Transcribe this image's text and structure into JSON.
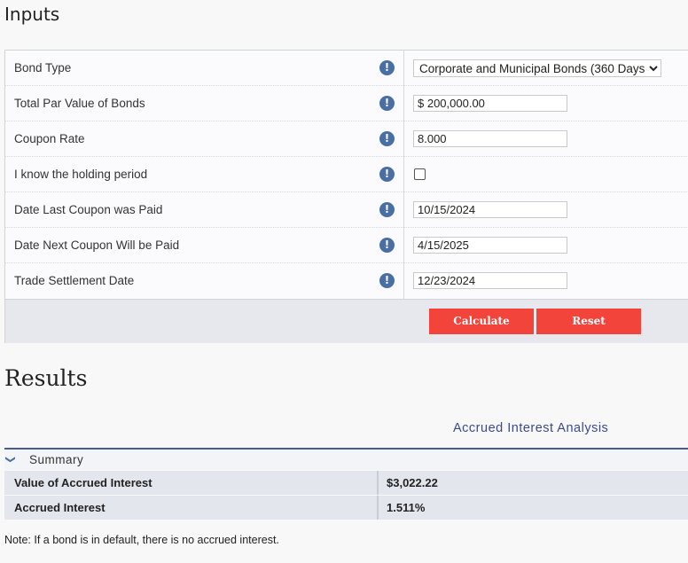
{
  "inputs": {
    "heading": "Inputs",
    "rows": [
      {
        "label": "Bond Type",
        "type": "select",
        "value": "Corporate and Municipal Bonds (360 Days)"
      },
      {
        "label": "Total Par Value of Bonds",
        "type": "text",
        "value": "$ 200,000.00"
      },
      {
        "label": "Coupon Rate",
        "type": "text",
        "value": "8.000"
      },
      {
        "label": "I know the holding period",
        "type": "checkbox",
        "checked": false
      },
      {
        "label": "Date Last Coupon was Paid",
        "type": "text",
        "value": "10/15/2024"
      },
      {
        "label": "Date Next Coupon Will be Paid",
        "type": "text",
        "value": "4/15/2025"
      },
      {
        "label": "Trade Settlement Date",
        "type": "text",
        "value": "12/23/2024"
      }
    ],
    "info_icon": "info-icon",
    "calculate_label": "Calculate",
    "reset_label": "Reset"
  },
  "results": {
    "heading": "Results",
    "analysis_title": "Accrued Interest Analysis",
    "summary_label": "Summary",
    "rows": [
      {
        "label": "Value of Accrued Interest",
        "value": "$3,022.22"
      },
      {
        "label": "Accrued Interest",
        "value": "1.511%"
      }
    ],
    "note": "Note: If a bond is in default, there is no accrued interest."
  },
  "colors": {
    "button": "#f2443a",
    "info_icon": "#4a6fa5",
    "accent": "#3b4a8c"
  }
}
